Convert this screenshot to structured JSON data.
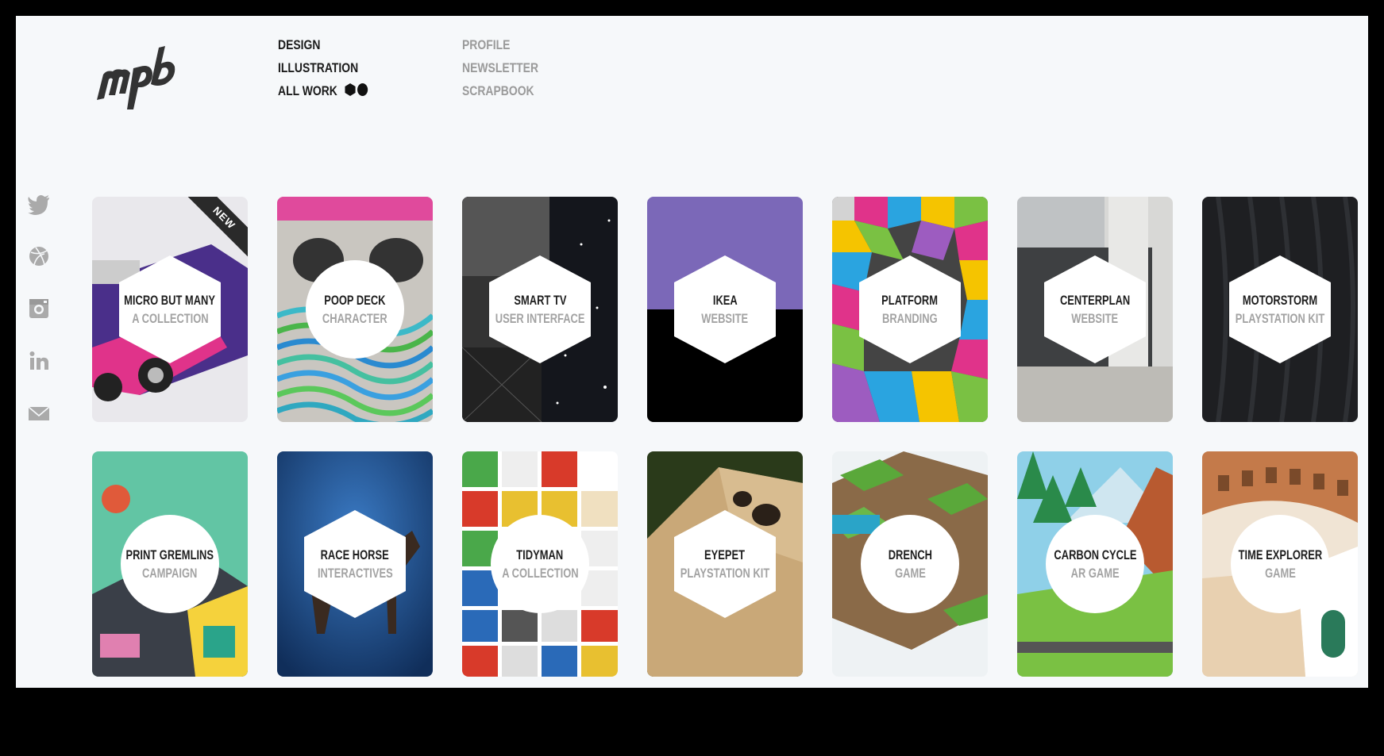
{
  "logo": {
    "text": "mpb"
  },
  "nav": {
    "primary": [
      "DESIGN",
      "ILLUSTRATION",
      "ALL WORK"
    ],
    "secondary": [
      "PROFILE",
      "NEWSLETTER",
      "SCRAPBOOK"
    ]
  },
  "social": [
    "twitter-icon",
    "dribbble-icon",
    "instagram-icon",
    "linkedin-icon",
    "mail-icon"
  ],
  "badge": "NEW",
  "projects": [
    {
      "title": "MICRO BUT MANY",
      "subtitle": "A COLLECTION"
    },
    {
      "title": "POOP DECK",
      "subtitle": "CHARACTER"
    },
    {
      "title": "SMART TV",
      "subtitle": "USER INTERFACE"
    },
    {
      "title": "IKEA",
      "subtitle": "WEBSITE"
    },
    {
      "title": "PLATFORM",
      "subtitle": "BRANDING"
    },
    {
      "title": "CENTERPLAN",
      "subtitle": "WEBSITE"
    },
    {
      "title": "MOTORSTORM",
      "subtitle": "PLAYSTATION KIT"
    },
    {
      "title": "PRINT GREMLINS",
      "subtitle": "CAMPAIGN"
    },
    {
      "title": "RACE HORSE",
      "subtitle": "INTERACTIVES"
    },
    {
      "title": "TIDYMAN",
      "subtitle": "A COLLECTION"
    },
    {
      "title": "EYEPET",
      "subtitle": "PLAYSTATION KIT"
    },
    {
      "title": "DRENCH",
      "subtitle": "GAME"
    },
    {
      "title": "CARBON CYCLE",
      "subtitle": "AR GAME"
    },
    {
      "title": "TIME EXPLORER",
      "subtitle": "GAME"
    }
  ],
  "colors": {
    "background": "#f6f8fa",
    "nav_active": "#1b1b1b",
    "nav_muted": "#9a9a9a",
    "ikea_purple": "#7b68b8"
  }
}
